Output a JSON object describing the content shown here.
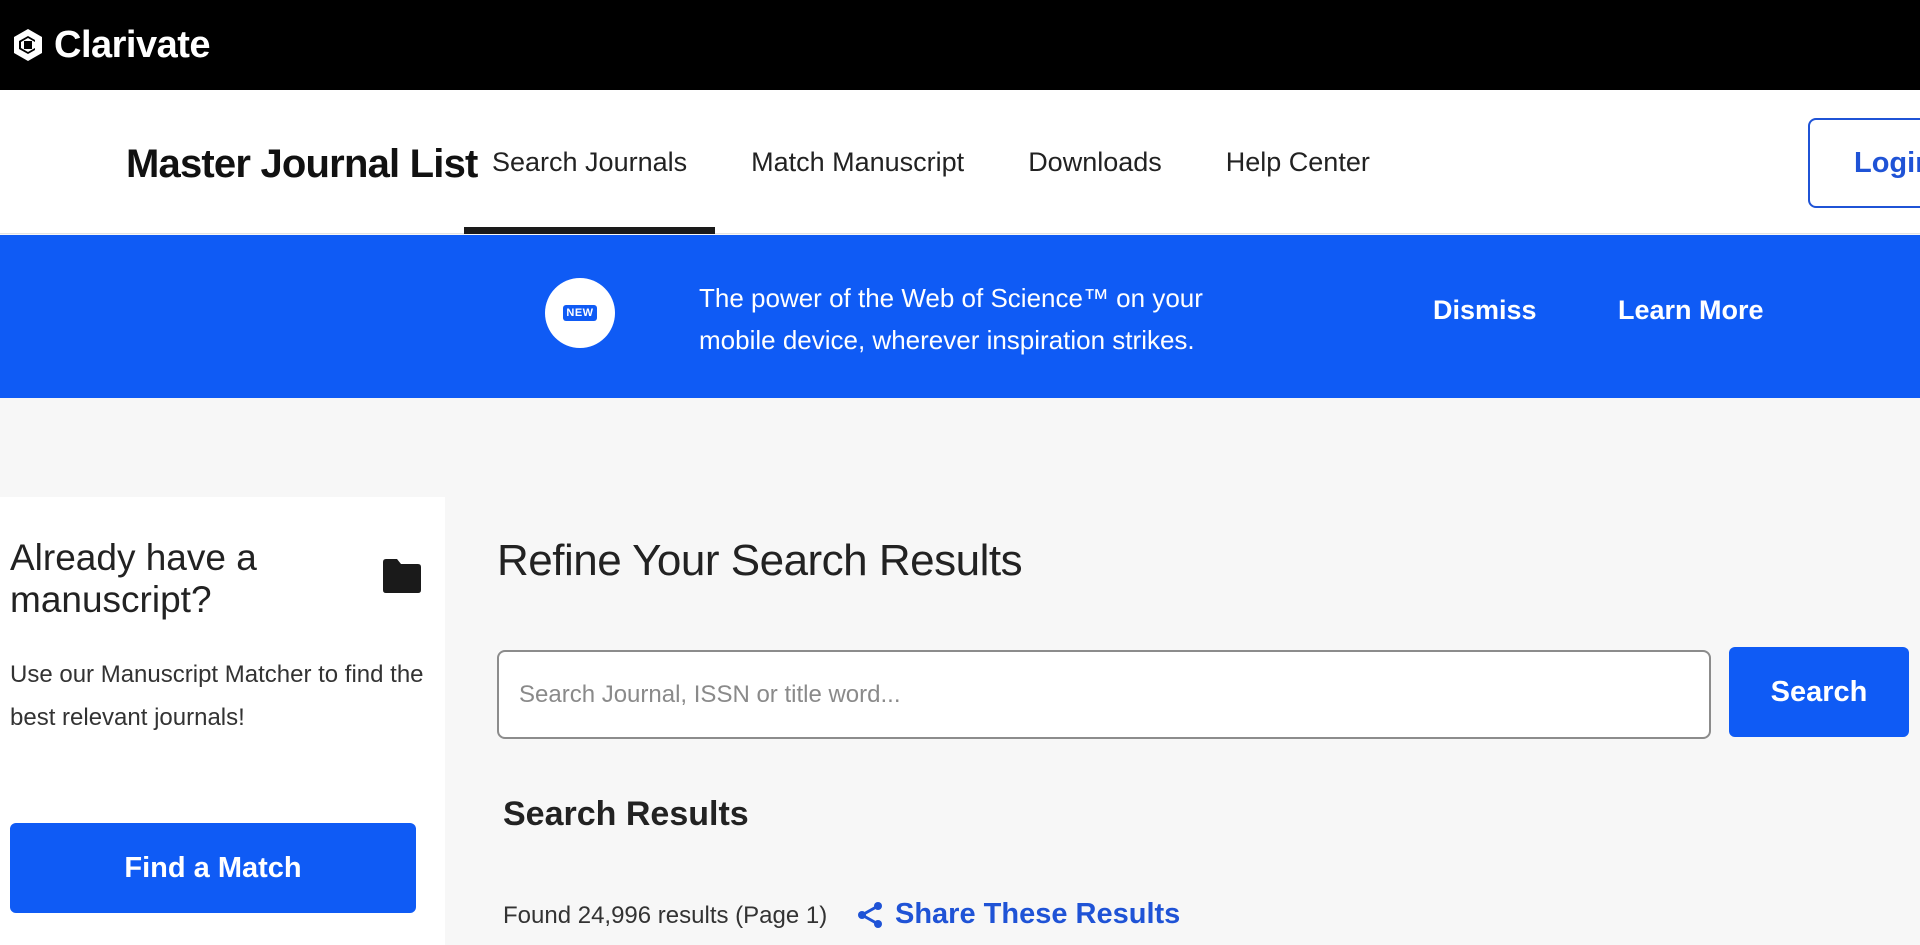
{
  "brand": {
    "name": "Clarivate",
    "icon": "clarivate-logo-icon"
  },
  "nav": {
    "site_title": "Master Journal List",
    "tabs": [
      {
        "label": "Search Journals",
        "active": true
      },
      {
        "label": "Match Manuscript",
        "active": false
      },
      {
        "label": "Downloads",
        "active": false
      },
      {
        "label": "Help Center",
        "active": false
      }
    ],
    "login_label": "Login"
  },
  "banner": {
    "badge": "NEW",
    "line1": "The power of the Web of Science™ on your",
    "line2": "mobile device, wherever inspiration strikes.",
    "dismiss_label": "Dismiss",
    "learn_more_label": "Learn More",
    "background_color": "#0f5bf5"
  },
  "match_card": {
    "heading": "Already have a manuscript?",
    "icon": "folder-icon",
    "text": "Use our Manuscript Matcher to find the best relevant journals!",
    "button_label": "Find a Match"
  },
  "main": {
    "refine_title": "Refine Your Search Results",
    "search": {
      "placeholder": "Search Journal, ISSN or title word...",
      "value": "",
      "button_label": "Search"
    },
    "results_heading": "Search Results",
    "results_count": "Found 24,996 results (Page 1)",
    "share_label": "Share These Results",
    "share_icon": "share-icon"
  },
  "colors": {
    "accent": "#0f5bf5",
    "link": "#1f53d6",
    "brand_bar": "#000000"
  }
}
